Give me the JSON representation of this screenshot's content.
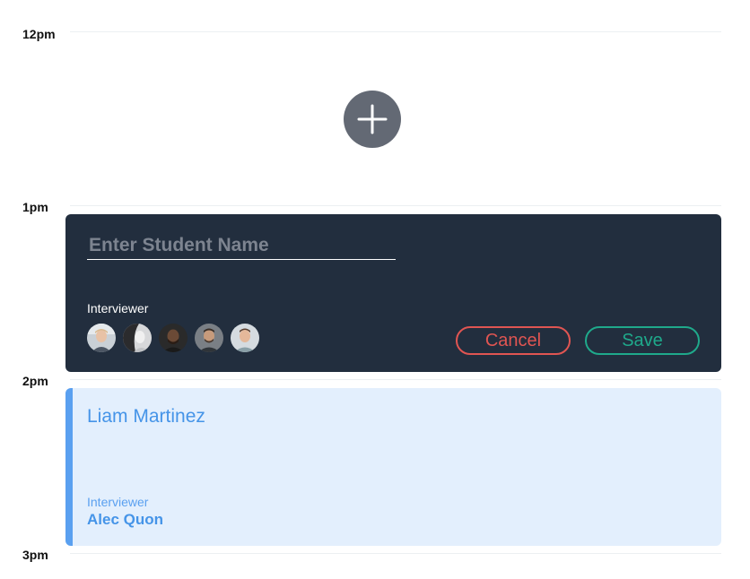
{
  "timeline": {
    "hours": [
      {
        "label": "12pm"
      },
      {
        "label": "1pm"
      },
      {
        "label": "2pm"
      },
      {
        "label": "3pm"
      }
    ]
  },
  "add_slot": {
    "icon": "plus-icon"
  },
  "editor": {
    "name_placeholder": "Enter Student Name",
    "name_value": "",
    "interviewer_label": "Interviewer",
    "avatars": [
      {
        "icon": "avatar-1"
      },
      {
        "icon": "avatar-2"
      },
      {
        "icon": "avatar-3"
      },
      {
        "icon": "avatar-4"
      },
      {
        "icon": "avatar-5"
      }
    ],
    "cancel_label": "Cancel",
    "save_label": "Save"
  },
  "event": {
    "student_name": "Liam Martinez",
    "interviewer_label": "Interviewer",
    "interviewer_name": "Alec Quon"
  },
  "colors": {
    "editor_bg": "#222e3e",
    "cancel": "#e05552",
    "save": "#1fa98b",
    "event_bg": "#e3effd",
    "event_accent": "#5aa0f0",
    "add_button": "#636974"
  }
}
